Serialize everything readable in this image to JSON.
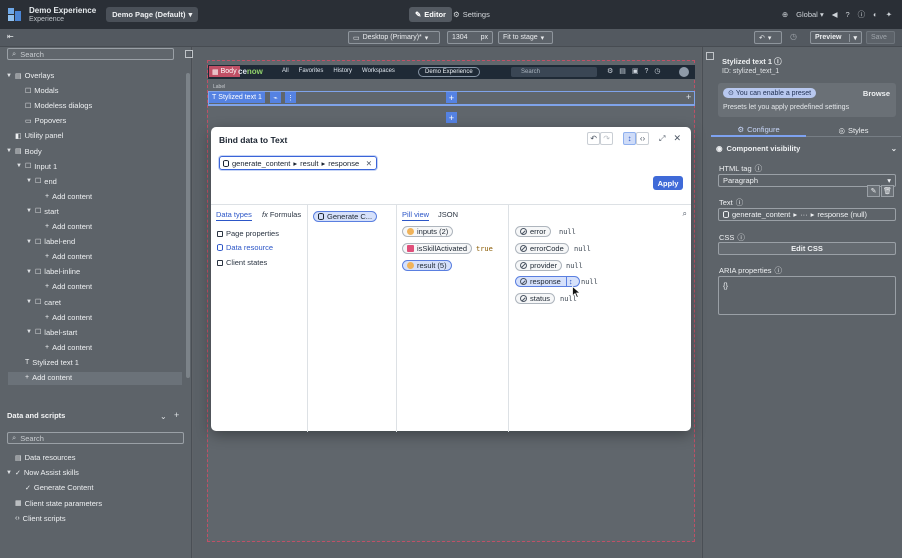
{
  "app": {
    "name": "Demo Experience",
    "subtitle": "Experience",
    "page_select": "Demo Page (Default)"
  },
  "top_tabs": {
    "editor": "Editor",
    "settings": "Settings"
  },
  "top_right": {
    "scope": "Global"
  },
  "toolbar": {
    "device": "Desktop (Primary)*",
    "width_value": "1304",
    "width_unit": "px",
    "fit": "Fit to stage",
    "preview": "Preview",
    "save": "Save"
  },
  "left": {
    "search_placeholder": "Search",
    "tree": [
      {
        "label": "Overlays",
        "indent": 0,
        "caret": "▼",
        "icon": "stack"
      },
      {
        "label": "Modals",
        "indent": 1,
        "caret": "",
        "icon": "square"
      },
      {
        "label": "Modeless dialogs",
        "indent": 1,
        "caret": "",
        "icon": "square"
      },
      {
        "label": "Popovers",
        "indent": 1,
        "caret": "",
        "icon": "popover"
      },
      {
        "label": "Utility panel",
        "indent": 0,
        "caret": "",
        "icon": "panel"
      },
      {
        "label": "Body",
        "indent": 0,
        "caret": "▼",
        "icon": "stack"
      },
      {
        "label": "Input 1",
        "indent": 1,
        "caret": "▼",
        "icon": "square"
      },
      {
        "label": "end",
        "indent": 2,
        "caret": "▼",
        "icon": "square"
      },
      {
        "label": "Add content",
        "indent": 3,
        "caret": "",
        "icon": "plus"
      },
      {
        "label": "start",
        "indent": 2,
        "caret": "▼",
        "icon": "square"
      },
      {
        "label": "Add content",
        "indent": 3,
        "caret": "",
        "icon": "plus"
      },
      {
        "label": "label-end",
        "indent": 2,
        "caret": "▼",
        "icon": "square"
      },
      {
        "label": "Add content",
        "indent": 3,
        "caret": "",
        "icon": "plus"
      },
      {
        "label": "label-inline",
        "indent": 2,
        "caret": "▼",
        "icon": "square"
      },
      {
        "label": "Add content",
        "indent": 3,
        "caret": "",
        "icon": "plus"
      },
      {
        "label": "caret",
        "indent": 2,
        "caret": "▼",
        "icon": "square"
      },
      {
        "label": "Add content",
        "indent": 3,
        "caret": "",
        "icon": "plus"
      },
      {
        "label": "label-start",
        "indent": 2,
        "caret": "▼",
        "icon": "square"
      },
      {
        "label": "Add content",
        "indent": 3,
        "caret": "",
        "icon": "plus"
      },
      {
        "label": "Stylized text 1",
        "indent": 1,
        "caret": "",
        "icon": "text"
      },
      {
        "label": "Add content",
        "indent": 1,
        "caret": "",
        "icon": "plus"
      }
    ],
    "data_section_title": "Data and scripts",
    "data_search_placeholder": "Search",
    "data_tree": [
      {
        "label": "Data resources",
        "indent": 0,
        "caret": "",
        "icon": "db"
      },
      {
        "label": "Now Assist skills",
        "indent": 0,
        "caret": "▼",
        "icon": "check"
      },
      {
        "label": "Generate Content",
        "indent": 1,
        "caret": "",
        "icon": "check"
      },
      {
        "label": "Client state parameters",
        "indent": 0,
        "caret": "",
        "icon": "grid"
      },
      {
        "label": "Client scripts",
        "indent": 0,
        "caret": "",
        "icon": "code"
      }
    ]
  },
  "canvas": {
    "body_tag": "Body",
    "brand": "now",
    "brand_prefix": "ce",
    "nav": [
      "All",
      "Favorites",
      "History",
      "Workspaces"
    ],
    "nav_center": "Demo Experience",
    "nav_search": "Search",
    "label_tag": "Label",
    "component_tag": "Stylized text 1"
  },
  "right": {
    "title": "Stylized text 1",
    "id_label": "ID: stylized_text_1",
    "preset_text": "You can enable a preset",
    "preset_browse": "Browse",
    "preset_desc": "Presets let you apply predefined settings",
    "tab_configure": "Configure",
    "tab_styles": "Styles",
    "visibility": "Component visibility",
    "html_tag_label": "HTML tag",
    "html_tag_value": "Paragraph",
    "text_label": "Text",
    "text_value_a": "generate_content",
    "text_value_b": "···",
    "text_value_c": "response (null)",
    "css_label": "CSS",
    "css_button": "Edit CSS",
    "aria_label": "ARIA properties",
    "aria_value": "{}"
  },
  "modal": {
    "title": "Bind data to Text",
    "expression": [
      "generate_content",
      "result",
      "response"
    ],
    "apply": "Apply",
    "tabs": {
      "data_types": "Data types",
      "formulas": "Formulas"
    },
    "data_types": [
      "Page properties",
      "Data resource",
      "Client states"
    ],
    "selected_resource": "Generate C...",
    "view_tabs": {
      "pill": "Pill view",
      "json": "JSON"
    },
    "props": [
      {
        "label": "inputs (2)",
        "icon": "brace"
      },
      {
        "label": "isSkillActivated",
        "icon": "check",
        "value": "true"
      },
      {
        "label": "result (5)",
        "icon": "brace"
      }
    ],
    "result_props": [
      {
        "label": "error",
        "value": "null"
      },
      {
        "label": "errorCode",
        "value": "null"
      },
      {
        "label": "provider",
        "value": "null"
      },
      {
        "label": "response",
        "value": "null"
      },
      {
        "label": "status",
        "value": "null"
      }
    ]
  },
  "colors": {
    "accent": "#3f6ad8",
    "topbar": "#2a2f36",
    "stage_border": "#c05066"
  }
}
